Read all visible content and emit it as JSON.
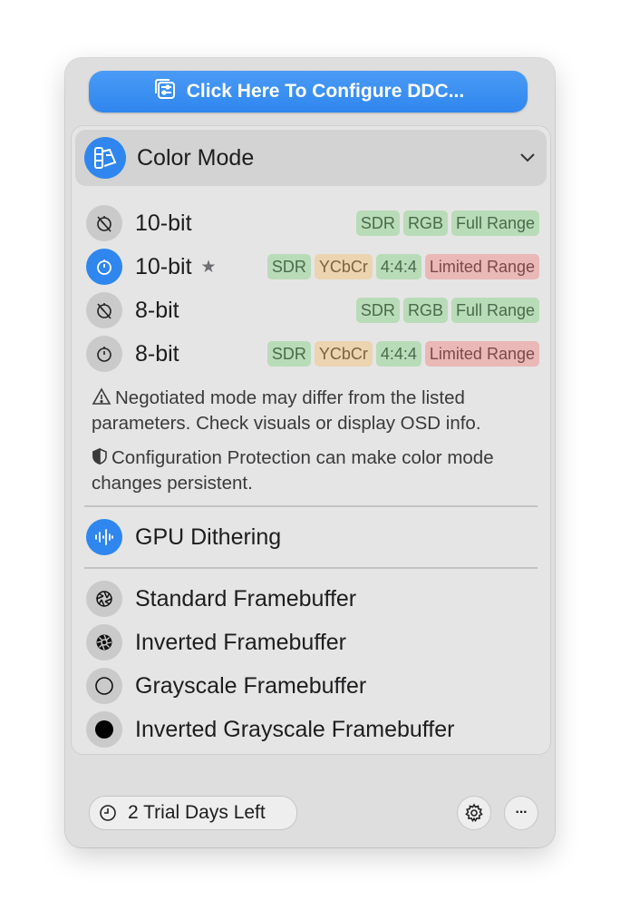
{
  "header": {
    "configure_label": "Click Here To Configure DDC..."
  },
  "color_mode": {
    "title": "Color Mode",
    "modes": [
      {
        "label": "10-bit",
        "starred": false,
        "selected": false,
        "tags": [
          {
            "text": "SDR",
            "color": "green"
          },
          {
            "text": "RGB",
            "color": "green"
          },
          {
            "text": "Full Range",
            "color": "green"
          }
        ]
      },
      {
        "label": "10-bit",
        "starred": true,
        "selected": true,
        "tags": [
          {
            "text": "SDR",
            "color": "green"
          },
          {
            "text": "YCbCr",
            "color": "orange"
          },
          {
            "text": "4:4:4",
            "color": "green"
          },
          {
            "text": "Limited Range",
            "color": "red"
          }
        ]
      },
      {
        "label": "8-bit",
        "starred": false,
        "selected": false,
        "tags": [
          {
            "text": "SDR",
            "color": "green"
          },
          {
            "text": "RGB",
            "color": "green"
          },
          {
            "text": "Full Range",
            "color": "green"
          }
        ]
      },
      {
        "label": "8-bit",
        "starred": false,
        "selected": false,
        "tags": [
          {
            "text": "SDR",
            "color": "green"
          },
          {
            "text": "YCbCr",
            "color": "orange"
          },
          {
            "text": "4:4:4",
            "color": "green"
          },
          {
            "text": "Limited Range",
            "color": "red"
          }
        ]
      }
    ],
    "star_glyph": "★",
    "warning_note": "Negotiated mode may differ from the listed parameters. Check visuals or display OSD info.",
    "protection_note": "Configuration Protection can make color mode changes persistent."
  },
  "gpu_dithering": {
    "label": "GPU Dithering"
  },
  "framebuffers": [
    {
      "label": "Standard Framebuffer",
      "icon": "aperture-icon"
    },
    {
      "label": "Inverted Framebuffer",
      "icon": "aperture-filled-icon"
    },
    {
      "label": "Grayscale Framebuffer",
      "icon": "circle-outline-icon"
    },
    {
      "label": "Inverted Grayscale Framebuffer",
      "icon": "circle-filled-icon"
    }
  ],
  "footer": {
    "trial_label": "2 Trial Days Left",
    "more_glyph": "···"
  },
  "colors": {
    "accent": "#2f86ee",
    "tag_green": "#b9dcb8",
    "tag_orange": "#ecd4b0",
    "tag_red": "#eab8b6"
  }
}
